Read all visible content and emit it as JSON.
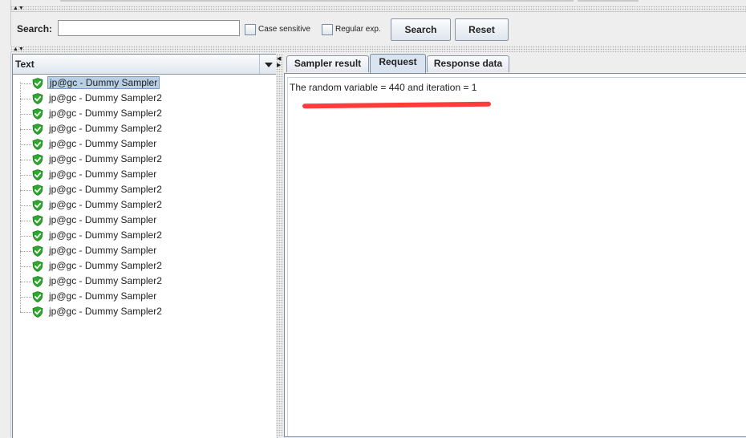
{
  "search": {
    "label": "Search:",
    "value": "",
    "placeholder": "",
    "case_sensitive_label": "Case sensitive",
    "case_sensitive_checked": false,
    "regular_exp_label": "Regular exp.",
    "regular_exp_checked": false,
    "search_button": "Search",
    "reset_button": "Reset"
  },
  "left_panel": {
    "renderer_selected": "Text",
    "tree_items": [
      {
        "label": "jp@gc - Dummy Sampler",
        "status": "success",
        "selected": true
      },
      {
        "label": "jp@gc - Dummy Sampler2",
        "status": "success"
      },
      {
        "label": "jp@gc - Dummy Sampler2",
        "status": "success"
      },
      {
        "label": "jp@gc - Dummy Sampler2",
        "status": "success"
      },
      {
        "label": "jp@gc - Dummy Sampler",
        "status": "success"
      },
      {
        "label": "jp@gc - Dummy Sampler2",
        "status": "success"
      },
      {
        "label": "jp@gc - Dummy Sampler",
        "status": "success"
      },
      {
        "label": "jp@gc - Dummy Sampler2",
        "status": "success"
      },
      {
        "label": "jp@gc - Dummy Sampler2",
        "status": "success"
      },
      {
        "label": "jp@gc - Dummy Sampler",
        "status": "success"
      },
      {
        "label": "jp@gc - Dummy Sampler2",
        "status": "success"
      },
      {
        "label": "jp@gc - Dummy Sampler",
        "status": "success"
      },
      {
        "label": "jp@gc - Dummy Sampler2",
        "status": "success"
      },
      {
        "label": "jp@gc - Dummy Sampler2",
        "status": "success"
      },
      {
        "label": "jp@gc - Dummy Sampler",
        "status": "success"
      },
      {
        "label": "jp@gc - Dummy Sampler2",
        "status": "success"
      }
    ]
  },
  "right_panel": {
    "tabs": [
      {
        "label": "Sampler result",
        "active": false
      },
      {
        "label": "Request",
        "active": true
      },
      {
        "label": "Response data",
        "active": false
      }
    ],
    "request_text": "The random variable = 440 and iteration = 1"
  },
  "colors": {
    "success_icon": "#2fa830",
    "selection_bg": "#b8cfe5",
    "annotation_red": "#ff3b3b"
  }
}
